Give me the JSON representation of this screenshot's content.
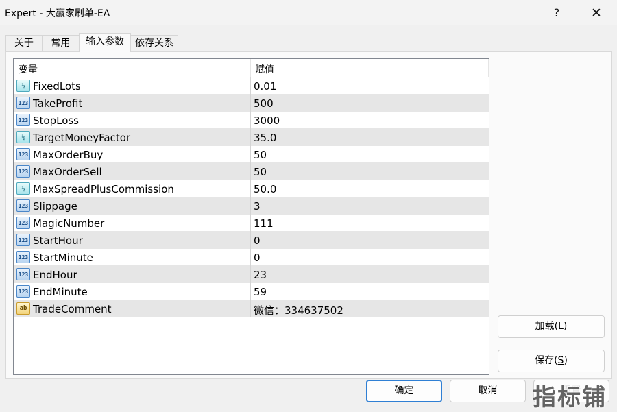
{
  "window": {
    "title": "Expert - 大赢家刷单-EA",
    "help_label": "?",
    "close_label": "✕"
  },
  "tabs": [
    {
      "label": "关于"
    },
    {
      "label": "常用"
    },
    {
      "label": "输入参数",
      "active": true
    },
    {
      "label": "依存关系"
    }
  ],
  "table": {
    "headers": {
      "variable": "变量",
      "value": "赋值"
    },
    "rows": [
      {
        "name": "FixedLots",
        "value": "0.01",
        "icon": "double-icon"
      },
      {
        "name": "TakeProfit",
        "value": "500",
        "icon": "int-icon"
      },
      {
        "name": "StopLoss",
        "value": "3000",
        "icon": "int-icon"
      },
      {
        "name": "TargetMoneyFactor",
        "value": "35.0",
        "icon": "double-icon"
      },
      {
        "name": "MaxOrderBuy",
        "value": "50",
        "icon": "int-icon"
      },
      {
        "name": "MaxOrderSell",
        "value": "50",
        "icon": "int-icon"
      },
      {
        "name": "MaxSpreadPlusCommission",
        "value": "50.0",
        "icon": "double-icon"
      },
      {
        "name": "Slippage",
        "value": "3",
        "icon": "int-icon"
      },
      {
        "name": "MagicNumber",
        "value": "111",
        "icon": "int-icon"
      },
      {
        "name": "StartHour",
        "value": "0",
        "icon": "int-icon"
      },
      {
        "name": "StartMinute",
        "value": "0",
        "icon": "int-icon"
      },
      {
        "name": "EndHour",
        "value": "23",
        "icon": "int-icon"
      },
      {
        "name": "EndMinute",
        "value": "59",
        "icon": "int-icon"
      },
      {
        "name": "TradeComment",
        "value": "微信：334637502",
        "icon": "string-icon"
      }
    ]
  },
  "side_buttons": {
    "load": {
      "text": "加载(",
      "key": "L",
      "end": ")"
    },
    "save": {
      "text": "保存(",
      "key": "S",
      "end": ")"
    }
  },
  "footer": {
    "ok_label": "确定",
    "cancel_label": "取消",
    "reset_label": "重置"
  },
  "watermark": "指标铺"
}
